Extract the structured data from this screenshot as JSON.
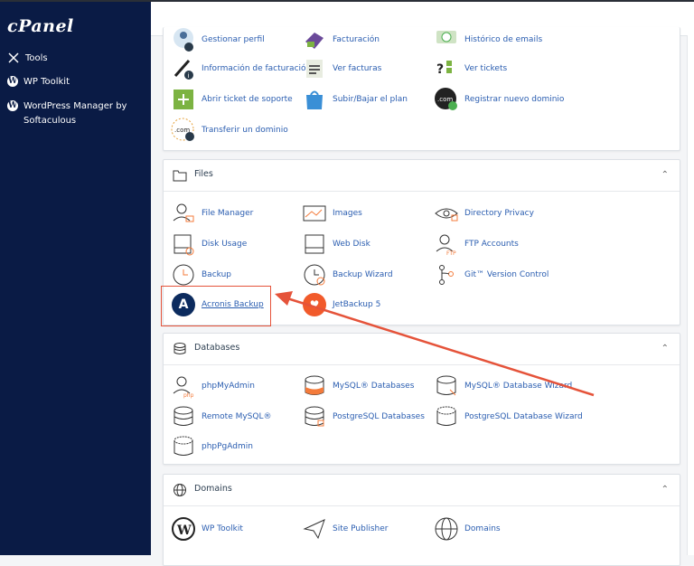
{
  "sidebar": {
    "logo": "cPanel",
    "items": [
      {
        "label": "Tools"
      },
      {
        "label": "WP Toolkit"
      },
      {
        "label": "WordPress Manager by Softaculous"
      }
    ]
  },
  "account_section": {
    "items": [
      {
        "label": "Gestionar perfil"
      },
      {
        "label": "Facturación"
      },
      {
        "label": "Histórico de emails"
      },
      {
        "label": "Información de facturación"
      },
      {
        "label": "Ver facturas"
      },
      {
        "label": "Ver tickets"
      },
      {
        "label": "Abrir ticket de soporte"
      },
      {
        "label": "Subir/Bajar el plan"
      },
      {
        "label": "Registrar nuevo dominio"
      },
      {
        "label": "Transferir un dominio"
      }
    ]
  },
  "files_section": {
    "title": "Files",
    "items": [
      {
        "label": "File Manager"
      },
      {
        "label": "Images"
      },
      {
        "label": "Directory Privacy"
      },
      {
        "label": "Disk Usage"
      },
      {
        "label": "Web Disk"
      },
      {
        "label": "FTP Accounts"
      },
      {
        "label": "Backup"
      },
      {
        "label": "Backup Wizard"
      },
      {
        "label": "Git™ Version Control"
      },
      {
        "label": "Acronis Backup"
      },
      {
        "label": "JetBackup 5"
      }
    ]
  },
  "databases_section": {
    "title": "Databases",
    "items": [
      {
        "label": "phpMyAdmin"
      },
      {
        "label": "MySQL® Databases"
      },
      {
        "label": "MySQL® Database Wizard"
      },
      {
        "label": "Remote MySQL®"
      },
      {
        "label": "PostgreSQL Databases"
      },
      {
        "label": "PostgreSQL Database Wizard"
      },
      {
        "label": "phpPgAdmin"
      }
    ]
  },
  "domains_section": {
    "title": "Domains",
    "items": [
      {
        "label": "WP Toolkit"
      },
      {
        "label": "Site Publisher"
      },
      {
        "label": "Domains"
      }
    ]
  },
  "colors": {
    "sidebar_bg": "#0a1b45",
    "link": "#2a5db0",
    "highlight": "#e5533a",
    "acronis": "#0c2b5e",
    "jetbackup": "#f15a2b"
  }
}
